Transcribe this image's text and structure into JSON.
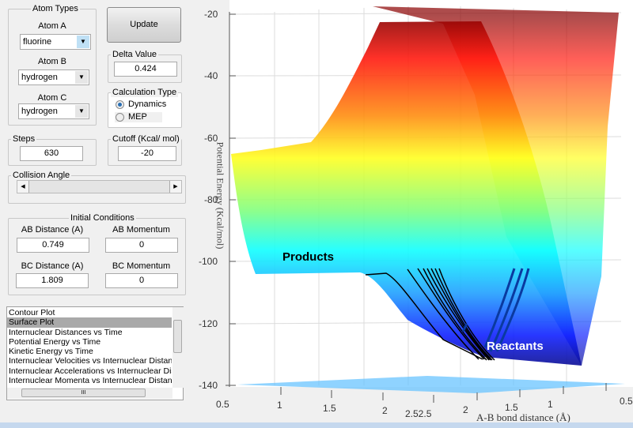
{
  "atom_types": {
    "title": "Atom Types",
    "atom_a_label": "Atom A",
    "atom_a_value": "fluorine",
    "atom_b_label": "Atom B",
    "atom_b_value": "hydrogen",
    "atom_c_label": "Atom C",
    "atom_c_value": "hydrogen"
  },
  "update_label": "Update",
  "delta": {
    "title": "Delta Value",
    "value": "0.424"
  },
  "calc_type": {
    "title": "Calculation Type",
    "options": [
      "Dynamics",
      "MEP"
    ],
    "selected": "Dynamics"
  },
  "steps": {
    "title": "Steps",
    "value": "630"
  },
  "cutoff": {
    "title": "Cutoff (Kcal/ mol)",
    "value": "-20"
  },
  "collision_angle": {
    "title": "Collision Angle",
    "slider_position": 0
  },
  "initial_conditions": {
    "title": "Initial Conditions",
    "ab_distance_label": "AB Distance (A)",
    "ab_distance": "0.749",
    "ab_momentum_label": "AB Momentum",
    "ab_momentum": "0",
    "bc_distance_label": "BC Distance (A)",
    "bc_distance": "1.809",
    "bc_momentum_label": "BC Momentum",
    "bc_momentum": "0"
  },
  "plot_list": {
    "items": [
      "Contour Plot",
      "Surface Plot",
      "Internuclear Distances vs Time",
      "Potential Energy vs Time",
      "Kinetic Energy vs Time",
      "Internuclear Velocities vs Internuclear Distance",
      "Internuclear Accelerations vs Internuclear Distance",
      "Internuclear Momenta vs Internuclear Distance"
    ],
    "selected": "Surface Plot",
    "hscroll_thumb": "III"
  },
  "plot": {
    "ylabel": "Potential Energy (Kcal/mol)",
    "xlabel": "A-B bond distance (Å)",
    "yticks": [
      "-20",
      "-40",
      "-60",
      "-80",
      "-100",
      "-120",
      "-140"
    ],
    "xticks": [
      "0.5",
      "1",
      "1.5",
      "2",
      "2.52.5",
      "2",
      "1.5",
      "1",
      "0.5"
    ],
    "products_label": "Products",
    "reactants_label": "Reactants",
    "colormap": "jet"
  }
}
